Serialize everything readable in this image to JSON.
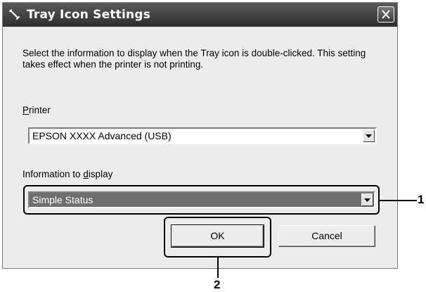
{
  "window": {
    "title": "Tray Icon Settings",
    "title_icon": "wrench-icon",
    "close_icon": "close-icon"
  },
  "dialog": {
    "description": "Select the information to display when the Tray icon is double-clicked. This setting takes effect when the printer is not printing.",
    "printer": {
      "label_mnemonic": "P",
      "label_rest": "rinter",
      "selected": "EPSON XXXX Advanced (USB)"
    },
    "info": {
      "label_before": "Information to ",
      "label_mnemonic": "d",
      "label_after": "isplay",
      "selected": "Simple Status"
    },
    "buttons": {
      "ok": "OK",
      "cancel": "Cancel"
    }
  },
  "callouts": {
    "one": "1",
    "two": "2"
  },
  "colors": {
    "titlebar": "#3a3a3a",
    "dialog_bg": "#ececec",
    "selected_bg": "#6e6e6e"
  }
}
